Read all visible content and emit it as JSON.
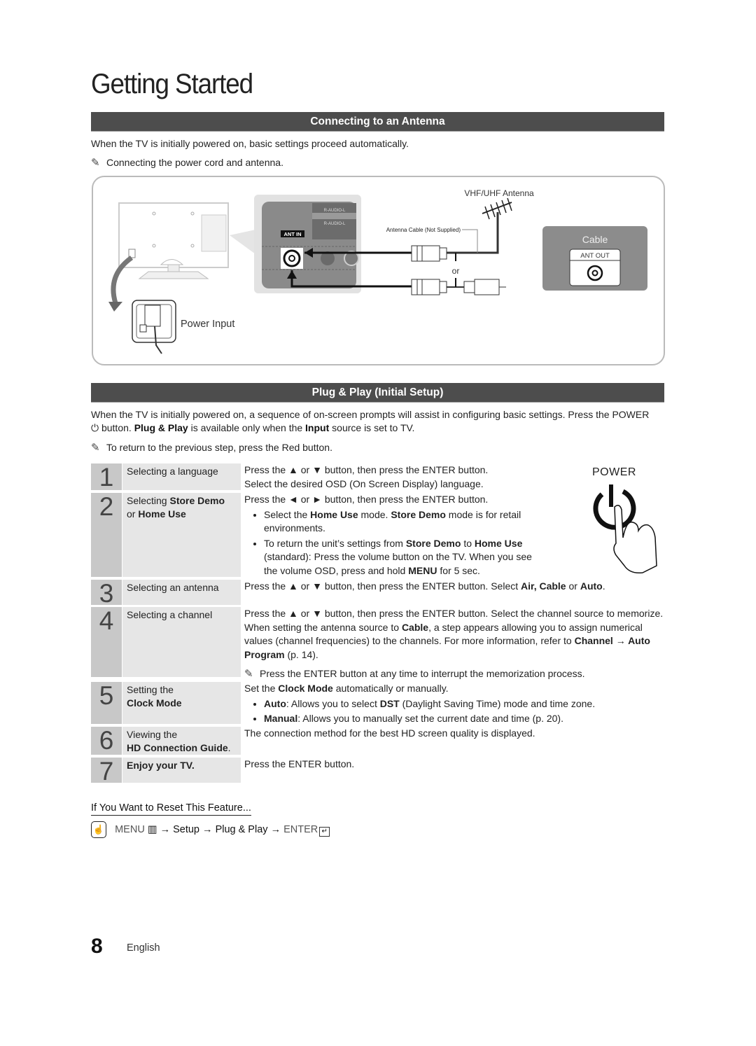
{
  "page": {
    "title": "Getting Started",
    "page_number": "8",
    "language": "English"
  },
  "antenna_section": {
    "heading": "Connecting to an Antenna",
    "intro": "When the TV is initially powered on, basic settings proceed automatically.",
    "note": "Connecting the power cord and antenna.",
    "diagram": {
      "power_input_label": "Power Input",
      "ant_in_label": "ANT IN",
      "audio_label_1": "R-AUDIO-L",
      "audio_label_2": "R-AUDIO-L",
      "antenna_label": "VHF/UHF Antenna",
      "cable_label": "Antenna Cable (Not Supplied)",
      "or_label": "or",
      "cable_box_title": "Cable",
      "ant_out_label": "ANT OUT"
    }
  },
  "plug_play_section": {
    "heading": "Plug & Play (Initial Setup)",
    "intro_1": "When the TV is initially powered on, a sequence of on-screen prompts will assist in configuring basic settings. Press the",
    "intro_power": "POWER",
    "intro_2": "button.",
    "intro_plug": "Plug & Play",
    "intro_3": "is available only when the",
    "intro_input": "Input",
    "intro_4": "source is set to TV.",
    "note": "To return to the previous step, press the Red button.",
    "power_illustration_label": "POWER",
    "steps": [
      {
        "number": "1",
        "label": "Selecting a language",
        "desc": "Press the ▲ or ▼ button, then press the ENTER button.",
        "desc2": "Select the desired OSD (On Screen Display) language."
      },
      {
        "number": "2",
        "label_pre": "Selecting",
        "label_b1": "Store Demo",
        "label_mid": "or",
        "label_b2": "Home Use",
        "desc": "Press the ◄ or ► button, then press the ENTER button.",
        "bullet_1_pre": "Select the",
        "bullet_1_b1": "Home Use",
        "bullet_1_mid": "mode.",
        "bullet_1_b2": "Store Demo",
        "bullet_1_post": "mode is for retail environments.",
        "bullet_2_pre": "To return the unit’s settings from",
        "bullet_2_b1": "Store Demo",
        "bullet_2_mid": "to",
        "bullet_2_b2": "Home Use",
        "bullet_2_post": "(standard): Press the volume button on the TV. When you see the volume OSD, press and hold",
        "bullet_2_b3": "MENU",
        "bullet_2_end": "for 5 sec."
      },
      {
        "number": "3",
        "label": "Selecting an antenna",
        "desc": "Press the ▲ or ▼ button, then press the ENTER button. Select",
        "desc_b1": "Air, Cable",
        "desc_mid": "or",
        "desc_b2": "Auto",
        "desc_end": "."
      },
      {
        "number": "4",
        "label": "Selecting a channel",
        "desc_1": "Press the ▲ or ▼ button, then press the ENTER button. Select the channel source to memorize. When setting the antenna source to",
        "desc_b1": "Cable",
        "desc_2": ", a step appears allowing you to assign numerical values (channel frequencies) to the channels. For more information, refer to",
        "desc_b2": "Channel → Auto Program",
        "desc_3": "(p. 14).",
        "note": "Press the ENTER button at any time to interrupt the memorization process."
      },
      {
        "number": "5",
        "label_pre": "Setting the",
        "label_b": "Clock Mode",
        "desc_pre": "Set the",
        "desc_b": "Clock Mode",
        "desc_post": "automatically or manually.",
        "bullet_1_b": "Auto",
        "bullet_1_pre": ": Allows you to select",
        "bullet_1_b2": "DST",
        "bullet_1_post": "(Daylight Saving Time) mode and time zone.",
        "bullet_2_b": "Manual",
        "bullet_2_post": ": Allows you to manually set the current date and time (p. 20)."
      },
      {
        "number": "6",
        "label_pre": "Viewing the",
        "label_b": "HD Connection Guide",
        "label_post": ".",
        "desc": "The connection method for the best HD screen quality is displayed."
      },
      {
        "number": "7",
        "label_b": "Enjoy your TV.",
        "desc": "Press the ENTER button."
      }
    ]
  },
  "reset": {
    "heading": "If You Want to Reset This Feature...",
    "menu": "MENU",
    "arrow": "→",
    "setup": "Setup",
    "plug_play": "Plug & Play",
    "enter": "ENTER"
  }
}
